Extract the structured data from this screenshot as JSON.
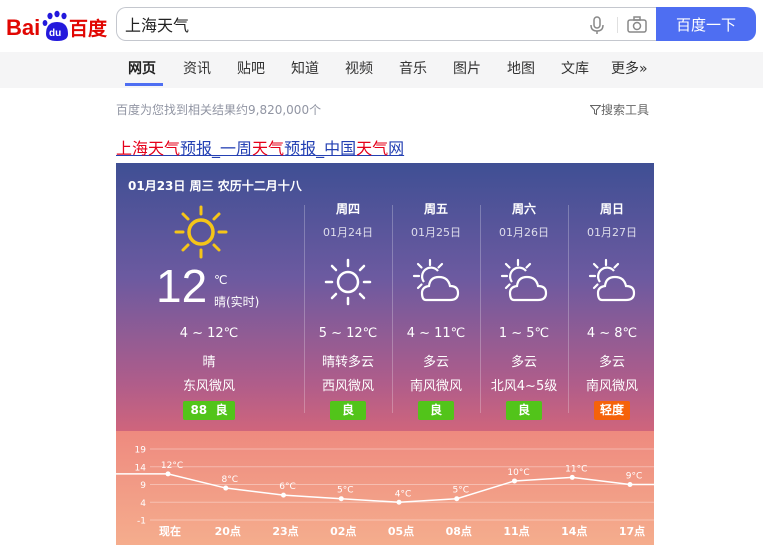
{
  "logo": {
    "text_left": "Bai",
    "text_paw": "du",
    "text_right": "百度"
  },
  "search": {
    "value": "上海天气",
    "button_label": "百度一下"
  },
  "nav": {
    "tabs": [
      {
        "label": "网页",
        "active": true
      },
      {
        "label": "资讯"
      },
      {
        "label": "贴吧"
      },
      {
        "label": "知道"
      },
      {
        "label": "视频"
      },
      {
        "label": "音乐"
      },
      {
        "label": "图片"
      },
      {
        "label": "地图"
      },
      {
        "label": "文库"
      },
      {
        "label": "更多»"
      }
    ]
  },
  "results": {
    "count_text": "百度为您找到相关结果约9,820,000个",
    "tools_label": "搜索工具"
  },
  "result": {
    "title_parts": [
      "上海",
      "天气",
      "预报_一周",
      "天气",
      "预报_中国",
      "天气",
      "网"
    ]
  },
  "weather": {
    "date_line": "01月23日 周三 农历十二月十八",
    "today": {
      "temp": "12",
      "unit": "℃",
      "condition": "晴(实时)",
      "range": "4 ~ 12℃",
      "desc": "晴",
      "wind": "东风微风",
      "aqi_value": "88",
      "aqi_label": "良",
      "aqi_color": "#52c41a"
    },
    "forecast": [
      {
        "day": "周四",
        "date": "01月24日",
        "icon": "sun-icon",
        "range": "5 ~ 12℃",
        "desc": "晴转多云",
        "wind": "西风微风",
        "aqi": "良",
        "aqi_color": "#52c41a"
      },
      {
        "day": "周五",
        "date": "01月25日",
        "icon": "partly-cloudy-icon",
        "range": "4 ~ 11℃",
        "desc": "多云",
        "wind": "南风微风",
        "aqi": "良",
        "aqi_color": "#52c41a"
      },
      {
        "day": "周六",
        "date": "01月26日",
        "icon": "partly-cloudy-icon",
        "range": "1 ~ 5℃",
        "desc": "多云",
        "wind": "北风4~5级",
        "aqi": "良",
        "aqi_color": "#52c41a"
      },
      {
        "day": "周日",
        "date": "01月27日",
        "icon": "partly-cloudy-icon",
        "range": "4 ~ 8℃",
        "desc": "多云",
        "wind": "南风微风",
        "aqi": "轻度",
        "aqi_color": "#f5620a"
      }
    ]
  },
  "chart_data": {
    "type": "line",
    "categories": [
      "现在",
      "20点",
      "23点",
      "02点",
      "05点",
      "08点",
      "11点",
      "14点",
      "17点"
    ],
    "values": [
      12,
      8,
      6,
      5,
      4,
      5,
      10,
      11,
      9
    ],
    "value_labels": [
      "12°C",
      "8°C",
      "6°C",
      "5°C",
      "4°C",
      "5°C",
      "10°C",
      "11°C",
      "9°C"
    ],
    "y_ticks": [
      19,
      14,
      9,
      4,
      -1
    ],
    "ylim": [
      -1,
      19
    ]
  }
}
